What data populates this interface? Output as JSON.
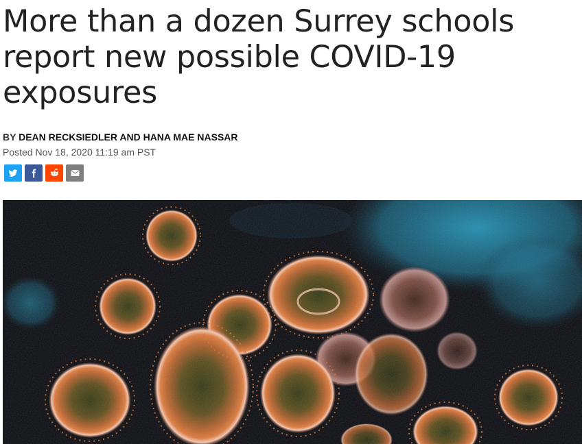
{
  "article": {
    "headline": "More than a dozen Surrey schools report new possible COVID-19 exposures",
    "byline_prefix": "BY",
    "authors": "DEAN RECKSIEDLER AND HANA MAE NASSAR",
    "posted": "Posted Nov 18, 2020 11:19 am PST"
  },
  "share": {
    "buttons": [
      {
        "name": "twitter",
        "icon": "twitter-icon",
        "color": "#1da1f2"
      },
      {
        "name": "facebook",
        "icon": "facebook-icon",
        "color": "#3b5998"
      },
      {
        "name": "reddit",
        "icon": "reddit-icon",
        "color": "#ff4500"
      },
      {
        "name": "email",
        "icon": "email-icon",
        "color": "#7f7f7f"
      }
    ]
  },
  "hero": {
    "icon": "coronavirus-micrograph-image",
    "colors": {
      "background": "#05070c",
      "cell_blue": "#1b8fb3",
      "virus_orange": "#d9732f",
      "virus_core": "#3b3a12",
      "virus_rim": "#f3c1a8"
    }
  }
}
